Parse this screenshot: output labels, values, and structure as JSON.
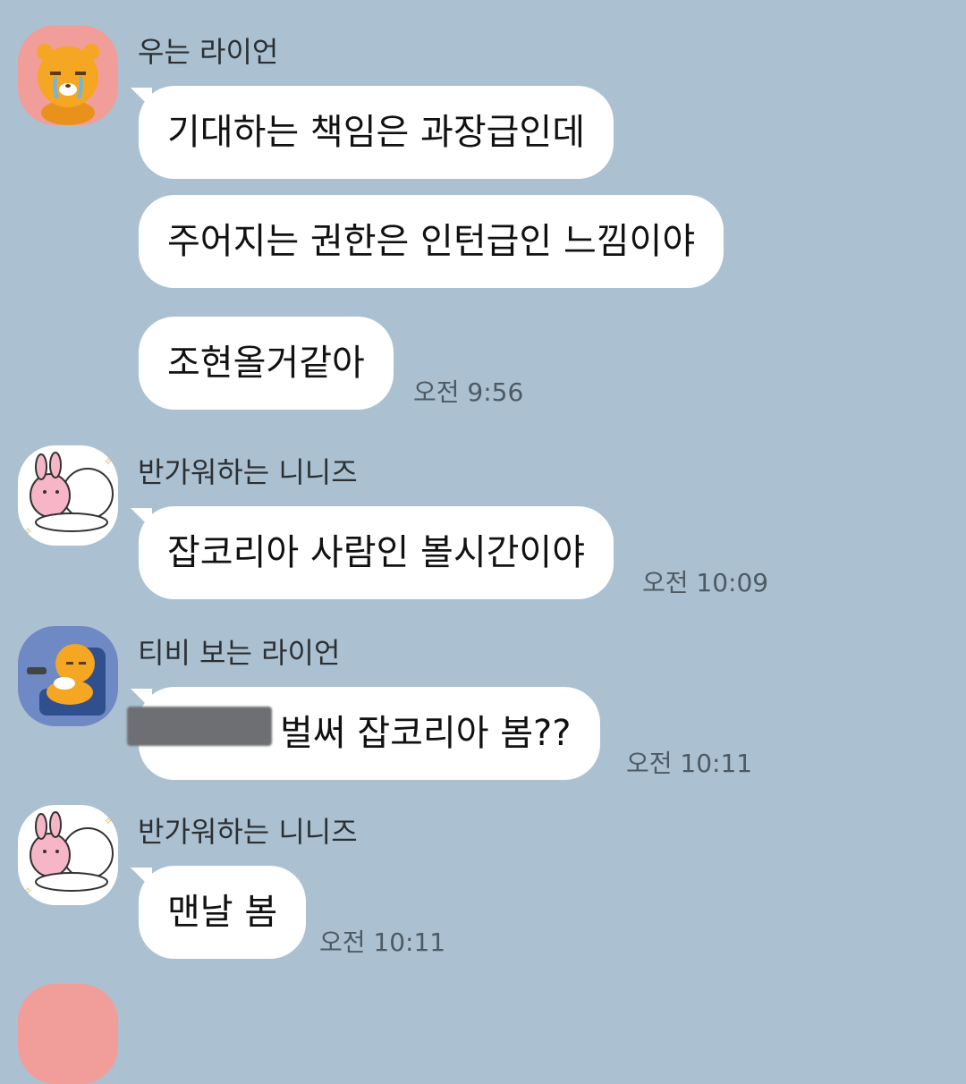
{
  "colors": {
    "background": "#abc1d1",
    "bubble": "#ffffff",
    "name_text": "#2b2f33",
    "time_text": "#4e5a63",
    "redaction": "#6d6f73"
  },
  "groups": [
    {
      "sender": "우는 라이언",
      "avatar_icon": "crying-lion-icon",
      "messages": [
        "기대하는 책임은 과장급인데",
        "주어지는 권한은 인턴급인 느낌이야",
        "조현올거같아"
      ],
      "time": "오전 9:56"
    },
    {
      "sender": "반가워하는 니니즈",
      "avatar_icon": "hugging-bunny-icon",
      "messages": [
        "잡코리아 사람인 볼시간이야"
      ],
      "time": "오전 10:09"
    },
    {
      "sender": "티비 보는 라이언",
      "avatar_icon": "lion-on-sofa-icon",
      "messages": [
        "벌써 잡코리아 봄??"
      ],
      "time": "오전 10:11"
    },
    {
      "sender": "반가워하는 니니즈",
      "avatar_icon": "hugging-bunny-icon",
      "messages": [
        "맨날 봄"
      ],
      "time": "오전 10:11"
    }
  ]
}
